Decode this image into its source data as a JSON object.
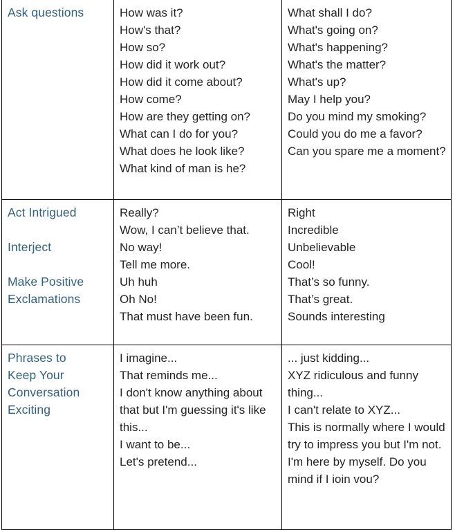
{
  "document": {
    "type": "reference-table",
    "accent_color": "#31617f",
    "text_color": "#242424",
    "border_color": "#000000",
    "background_color": "#ffffff"
  },
  "table": {
    "column_count": 3,
    "row_count": 3,
    "rows": [
      {
        "id": "ask-questions",
        "headings": [
          [
            "Ask questions"
          ]
        ],
        "middle_column": [
          "How was it?",
          "How's that?",
          "How so?",
          "How did it work out?",
          "How did it come about?",
          "How come?",
          "How are they getting on?",
          "What can I do for you?",
          "What does he look like?",
          "What kind of man is he?"
        ],
        "right_column": [
          "What shall I do?",
          "What's going on?",
          "What's happening?",
          "What's the matter?",
          "What's up?",
          "May I help you?",
          "Do you mind my smoking?",
          "Could you do me a favor?",
          "Can you spare me a moment?"
        ]
      },
      {
        "id": "act-intrigued",
        "headings": [
          [
            "Act Intrigued"
          ],
          [
            "Interject"
          ],
          [
            "Make Positive",
            "Exclamations"
          ]
        ],
        "middle_column": [
          "Really?",
          "Wow, I can’t believe that.",
          "No way!",
          "Tell me more.",
          "Uh huh",
          "Oh No!",
          "That must have been fun."
        ],
        "right_column": [
          "Right",
          "Incredible",
          "Unbelievable",
          "Cool!",
          "That’s so funny.",
          "That’s great.",
          "Sounds interesting"
        ]
      },
      {
        "id": "phrases-to-keep-conversation-exciting",
        "headings": [
          [
            "Phrases to",
            "Keep Your",
            "Conversation",
            "Exciting"
          ]
        ],
        "middle_column": [
          "I imagine...",
          "That reminds me...",
          "I don't know anything about that but I'm guessing it's like this...",
          "I want to be...",
          "Let's pretend..."
        ],
        "right_column": [
          "... just kidding...",
          "XYZ ridiculous and funny thing...",
          "I can't relate to XYZ...",
          "This is normally where I would try to impress you but I'm not.",
          "I'm here by myself. Do you mind if I ioin vou?"
        ]
      }
    ]
  }
}
